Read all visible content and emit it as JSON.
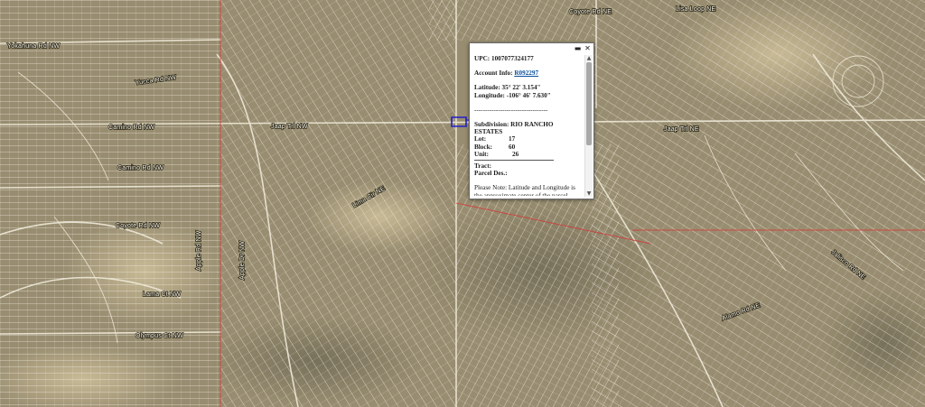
{
  "map": {
    "road_labels": [
      "Yokahuna Rd NW",
      "Yucca Rd NW",
      "Camino Rd NW",
      "Jaap Trl NW",
      "Camino Rd NW",
      "Coyote Rd NW",
      "Lama Ct NW",
      "Olympus Ct NW",
      "Apple Rd NW",
      "Lima Cir NE",
      "Lisa Loop NE",
      "Coyote Rd NE",
      "Jaap Trl NE",
      "Apple Dr NW",
      "Jalisco Rd NE",
      "Alamo Rd NE"
    ],
    "colors": {
      "terrain": "#9a8f72",
      "parcel_line": "#f1ece0",
      "boundary": "#d23a3a",
      "selection": "#2020c8"
    }
  },
  "popup": {
    "upc_label": "UPC:",
    "upc_value": "1007077324177",
    "account_label": "Account Info:",
    "account_value": "R092297",
    "lat_label": "Latitude:",
    "lat_value": "35° 22' 3.154\"",
    "lon_label": "Longitude:",
    "lon_value": "-106° 46' 7.630\"",
    "separator": "----------------------------------",
    "subdivision_label": "Subdivision:",
    "subdivision_value": "RIO RANCHO ESTATES",
    "lot_label": "Lot:",
    "lot_value": "17",
    "block_label": "Block:",
    "block_value": "60",
    "unit_label": "Unit:",
    "unit_value": "26",
    "tract_label": "Tract:",
    "parcel_label": "Parcel Des.:",
    "note": "Please Note: Latitude and Longitude is the approximate center of the parcel shown.",
    "maximize_icon": "maximize-icon",
    "close_icon": "close-icon"
  }
}
